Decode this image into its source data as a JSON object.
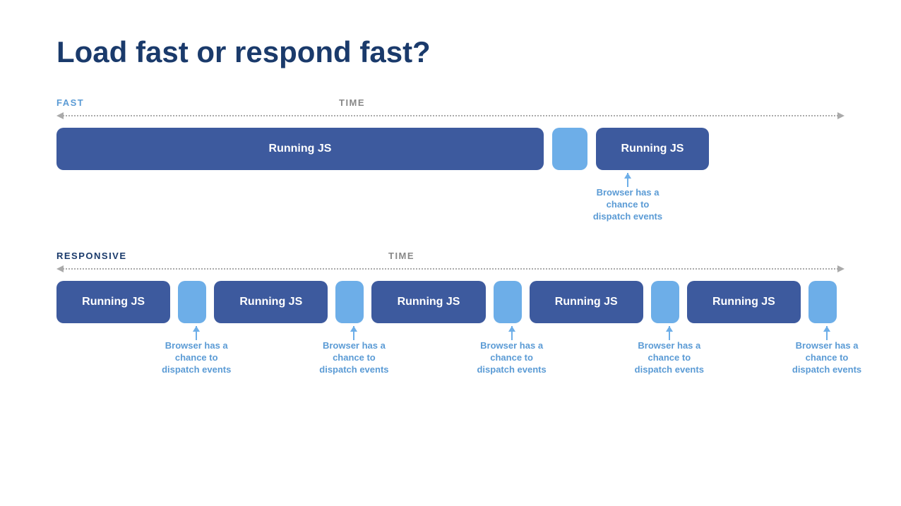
{
  "title": "Load fast or respond fast?",
  "fast_section": {
    "label": "FAST",
    "time_label": "TIME",
    "blocks": [
      {
        "type": "js",
        "size": "large",
        "label": "Running JS"
      },
      {
        "type": "gap",
        "size": "w50"
      },
      {
        "type": "js",
        "size": "medium",
        "label": "Running JS"
      }
    ],
    "annotation": {
      "text_line1": "Browser has a",
      "text_line2": "chance to",
      "text_line3": "dispatch events"
    }
  },
  "responsive_section": {
    "label": "RESPONSIVE",
    "time_label": "TIME",
    "blocks": [
      {
        "type": "js",
        "label": "Running JS"
      },
      {
        "type": "gap"
      },
      {
        "type": "js",
        "label": "Running JS"
      },
      {
        "type": "gap"
      },
      {
        "type": "js",
        "label": "Running JS"
      },
      {
        "type": "gap"
      },
      {
        "type": "js",
        "label": "Running JS"
      },
      {
        "type": "gap"
      },
      {
        "type": "js",
        "label": "Running JS"
      },
      {
        "type": "gap-end"
      }
    ],
    "annotation_text_line1": "Browser has a",
    "annotation_text_line2": "chance to",
    "annotation_text_line3": "dispatch events"
  },
  "colors": {
    "js_block": "#3d5a9e",
    "gap_block": "#6daee8",
    "title": "#1a3a6b",
    "label_fast": "#5b9bd5",
    "label_responsive": "#1a3a6b",
    "annotation_text": "#5b9bd5",
    "timeline": "#aaaaaa"
  }
}
